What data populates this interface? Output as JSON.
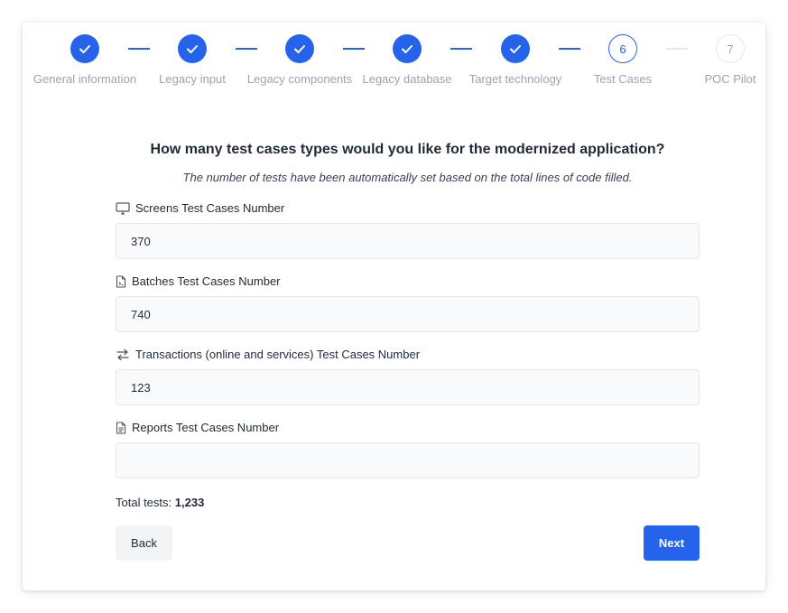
{
  "stepper": {
    "steps": [
      {
        "label": "General information",
        "status": "done"
      },
      {
        "label": "Legacy input",
        "status": "done"
      },
      {
        "label": "Legacy components",
        "status": "done"
      },
      {
        "label": "Legacy database",
        "status": "done"
      },
      {
        "label": "Target technology",
        "status": "done"
      },
      {
        "label": "Test Cases",
        "number": "6",
        "status": "current"
      },
      {
        "label": "POC Pilot",
        "number": "7",
        "status": "todo"
      }
    ]
  },
  "form": {
    "title": "How many test cases types would you like for the modernized application?",
    "subtitle": "The number of tests have been automatically set based on the total lines of code filled.",
    "fields": [
      {
        "label": "Screens Test Cases Number",
        "icon": "monitor-icon",
        "value": "370",
        "placeholder": ""
      },
      {
        "label": "Batches Test Cases Number",
        "icon": "batch-file-icon",
        "value": "740",
        "placeholder": ""
      },
      {
        "label": "Transactions (online and services) Test Cases Number",
        "icon": "arrows-exchange-icon",
        "value": "123",
        "placeholder": ""
      },
      {
        "label": "Reports Test Cases Number",
        "icon": "report-file-icon",
        "value": "",
        "placeholder": ""
      }
    ],
    "total_label": "Total tests:",
    "total_value": "1,233"
  },
  "actions": {
    "back_label": "Back",
    "next_label": "Next"
  },
  "colors": {
    "primary": "#2563eb",
    "muted": "#9ca3af"
  }
}
